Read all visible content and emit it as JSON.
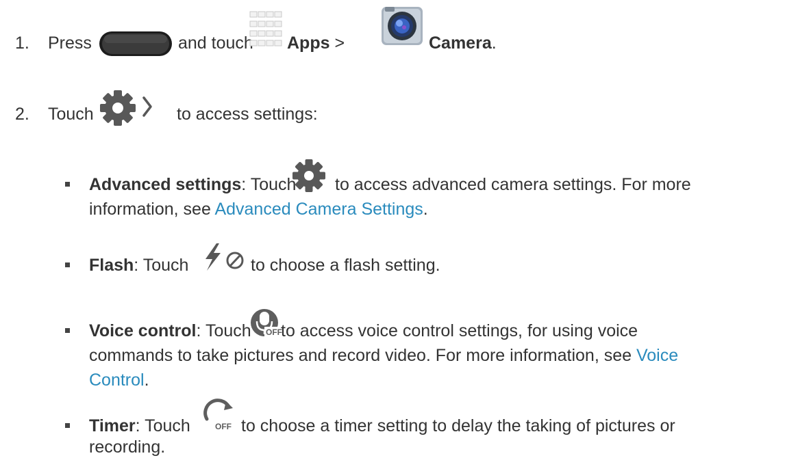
{
  "step1": {
    "number": "1.",
    "press": "Press",
    "and_touch": "and touch",
    "apps": "Apps",
    "gt": ">",
    "camera": "Camera",
    "period": "."
  },
  "step2": {
    "number": "2.",
    "touch": "Touch",
    "rest": "to access settings:"
  },
  "items": [
    {
      "term": "Advanced settings",
      "colon_touch": ": Touch",
      "text1": "to access advanced camera settings. For more",
      "text2": "information, see",
      "link": "Advanced Camera Settings",
      "end": "."
    },
    {
      "term": "Flash",
      "colon_touch": ": Touch",
      "text1": "to choose a flash setting."
    },
    {
      "term": "Voice control",
      "colon_touch": ": Touch",
      "text1": "to access voice control settings, for using voice",
      "text2": "commands to take pictures and record video. For more information, see",
      "link_a": "Voice",
      "link_b": "Control",
      "end": "."
    },
    {
      "term": "Timer",
      "colon_touch": ": Touch",
      "text1": "to choose a timer setting to delay the taking of pictures or",
      "text2": "recording."
    }
  ],
  "icons": {
    "home_button": "home-button-icon",
    "apps": "apps-grid-icon",
    "camera": "camera-app-icon",
    "settings_expand": "gear-chevron-icon",
    "gear": "gear-icon",
    "flash_off": "flash-off-icon",
    "voice_off": "voice-control-off-icon",
    "timer_off": "timer-off-icon"
  },
  "colors": {
    "link": "#2a8bbd",
    "text": "#333333"
  }
}
